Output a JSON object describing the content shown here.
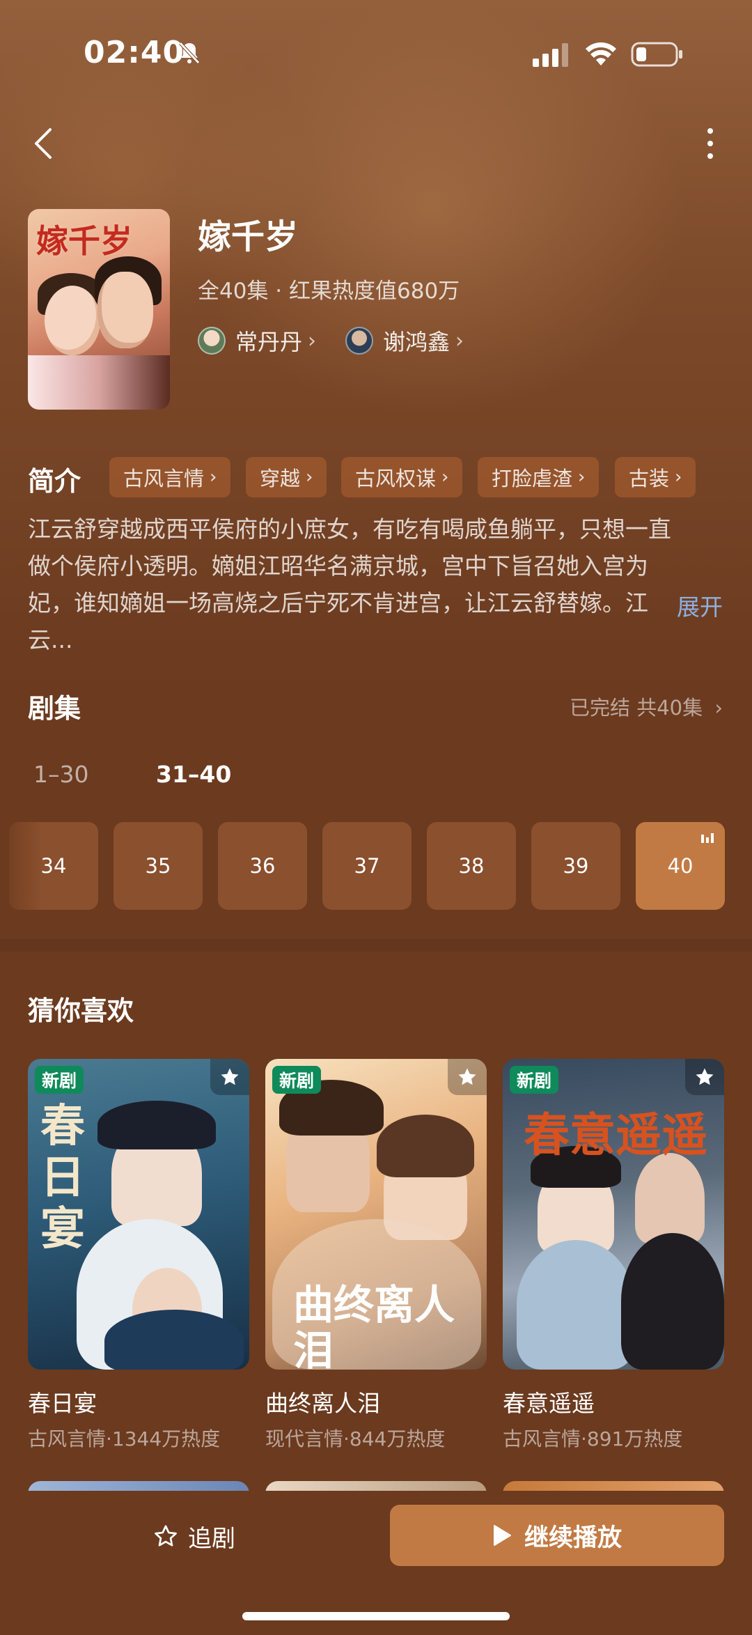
{
  "status_bar": {
    "time": "02:40"
  },
  "drama": {
    "poster_title": "嫁千岁",
    "title": "嫁千岁",
    "meta": "全40集 · 红果热度值680万",
    "actors": [
      {
        "name": "常丹丹"
      },
      {
        "name": "谢鸿鑫"
      }
    ]
  },
  "intro": {
    "label": "简介",
    "tags": [
      "古风言情",
      "穿越",
      "古风权谋",
      "打脸虐渣",
      "古装"
    ],
    "text": "江云舒穿越成西平侯府的小庶女，有吃有喝咸鱼躺平，只想一直做个侯府小透明。嫡姐江昭华名满京城，宫中下旨召她入宫为妃，谁知嫡姐一场高烧之后宁死不肯进宫，让江云舒替嫁。江云...",
    "expand": "展开"
  },
  "episodes": {
    "title": "剧集",
    "status": "已完结 共40集",
    "ranges": [
      "1–30",
      "31–40"
    ],
    "items": [
      "34",
      "35",
      "36",
      "37",
      "38",
      "39",
      "40"
    ],
    "active": "40"
  },
  "recommend": {
    "title": "猜你喜欢",
    "cards": [
      {
        "badge": "新剧",
        "poster_text": "春日宴",
        "name": "春日宴",
        "meta": "古风言情·1344万热度"
      },
      {
        "badge": "新剧",
        "poster_text": "曲终离人泪",
        "name": "曲终离人泪",
        "meta": "现代言情·844万热度"
      },
      {
        "badge": "新剧",
        "poster_text": "春意遥遥",
        "name": "春意遥遥",
        "meta": "古风言情·891万热度"
      }
    ]
  },
  "bottom": {
    "follow": "追剧",
    "play": "继续播放"
  },
  "icons": [
    "mute-icon",
    "signal-icon",
    "wifi-icon",
    "battery-icon",
    "back-icon",
    "more-icon",
    "chevron-right-icon",
    "star-icon",
    "play-icon",
    "playing-indicator-icon"
  ],
  "colors": {
    "background": "#6b3a1f",
    "accent": "#c27a44",
    "badge": "#0f8a5a",
    "link": "#8fb0e0"
  }
}
